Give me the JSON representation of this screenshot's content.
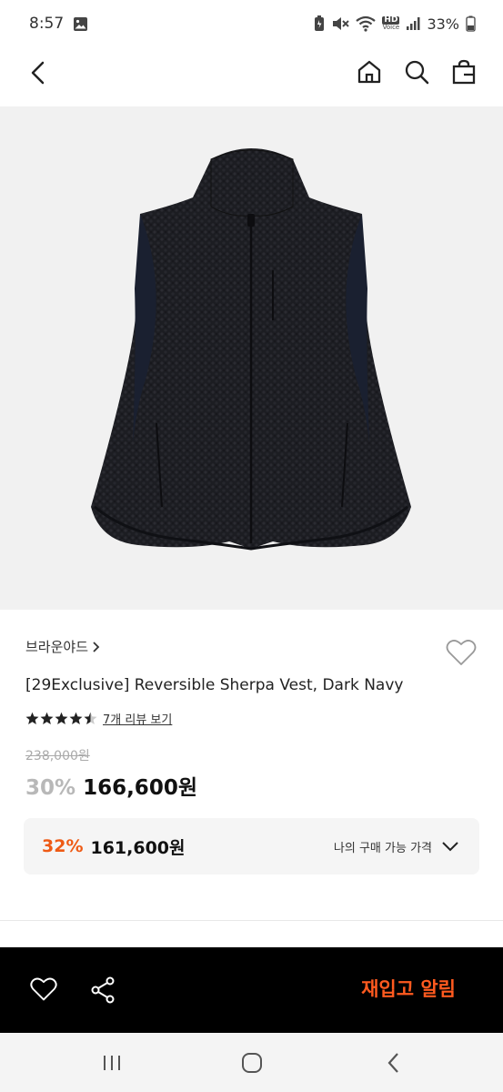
{
  "status_bar": {
    "time": "8:57",
    "battery": "33%",
    "icons": [
      "image-icon",
      "battery-saver-icon",
      "mute-icon",
      "wifi-icon",
      "hd-voice-icon",
      "signal-icon",
      "battery-icon"
    ],
    "hd_label": "HD",
    "voice_label": "Voice"
  },
  "nav": {
    "icons": [
      "back-icon",
      "home-icon",
      "search-icon",
      "shopping-bag-icon"
    ]
  },
  "product": {
    "brand": "브라운야드",
    "title": "[29Exclusive] Reversible Sherpa Vest, Dark Navy",
    "rating": 4.5,
    "review_link": "7개 리뷰 보기",
    "original_price": "238,000원",
    "discount": "30%",
    "price": "166,600원"
  },
  "my_price": {
    "discount": "32%",
    "price": "161,600원",
    "label": "나의 구매 가능 가격"
  },
  "bottom_bar": {
    "restock_label": "재입고 알림"
  },
  "colors": {
    "accent": "#ee5a15",
    "restock": "#ff5a1f",
    "image_bg": "#f1f1f1"
  }
}
